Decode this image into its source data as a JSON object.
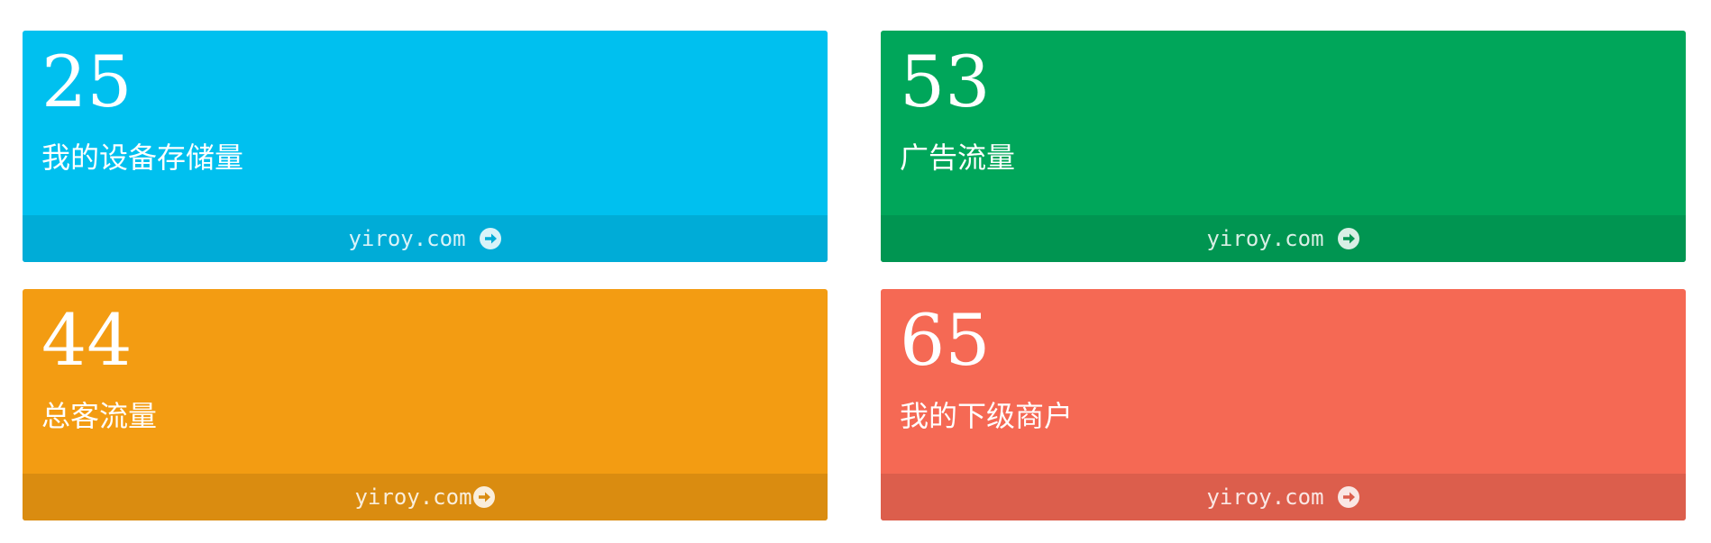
{
  "cards": [
    {
      "value": "25",
      "label": "我的设备存储量",
      "footer_text": "yiroy.com",
      "bg": "#00c0ef",
      "footer_bg": "#00acd7",
      "icon": "arrow-circle-right-icon"
    },
    {
      "value": "53",
      "label": "广告流量",
      "footer_text": "yiroy.com",
      "bg": "#00a65a",
      "footer_bg": "#009551",
      "icon": "arrow-circle-right-icon"
    },
    {
      "value": "44",
      "label": "总客流量",
      "footer_text": "yiroy.com",
      "bg": "#f39c12",
      "footer_bg": "#da8c10",
      "icon": "arrow-circle-right-icon"
    },
    {
      "value": "65",
      "label": "我的下级商户",
      "footer_text": "yiroy.com",
      "bg": "#f56954",
      "footer_bg": "#dc5e4c",
      "icon": "arrow-circle-right-icon"
    }
  ]
}
